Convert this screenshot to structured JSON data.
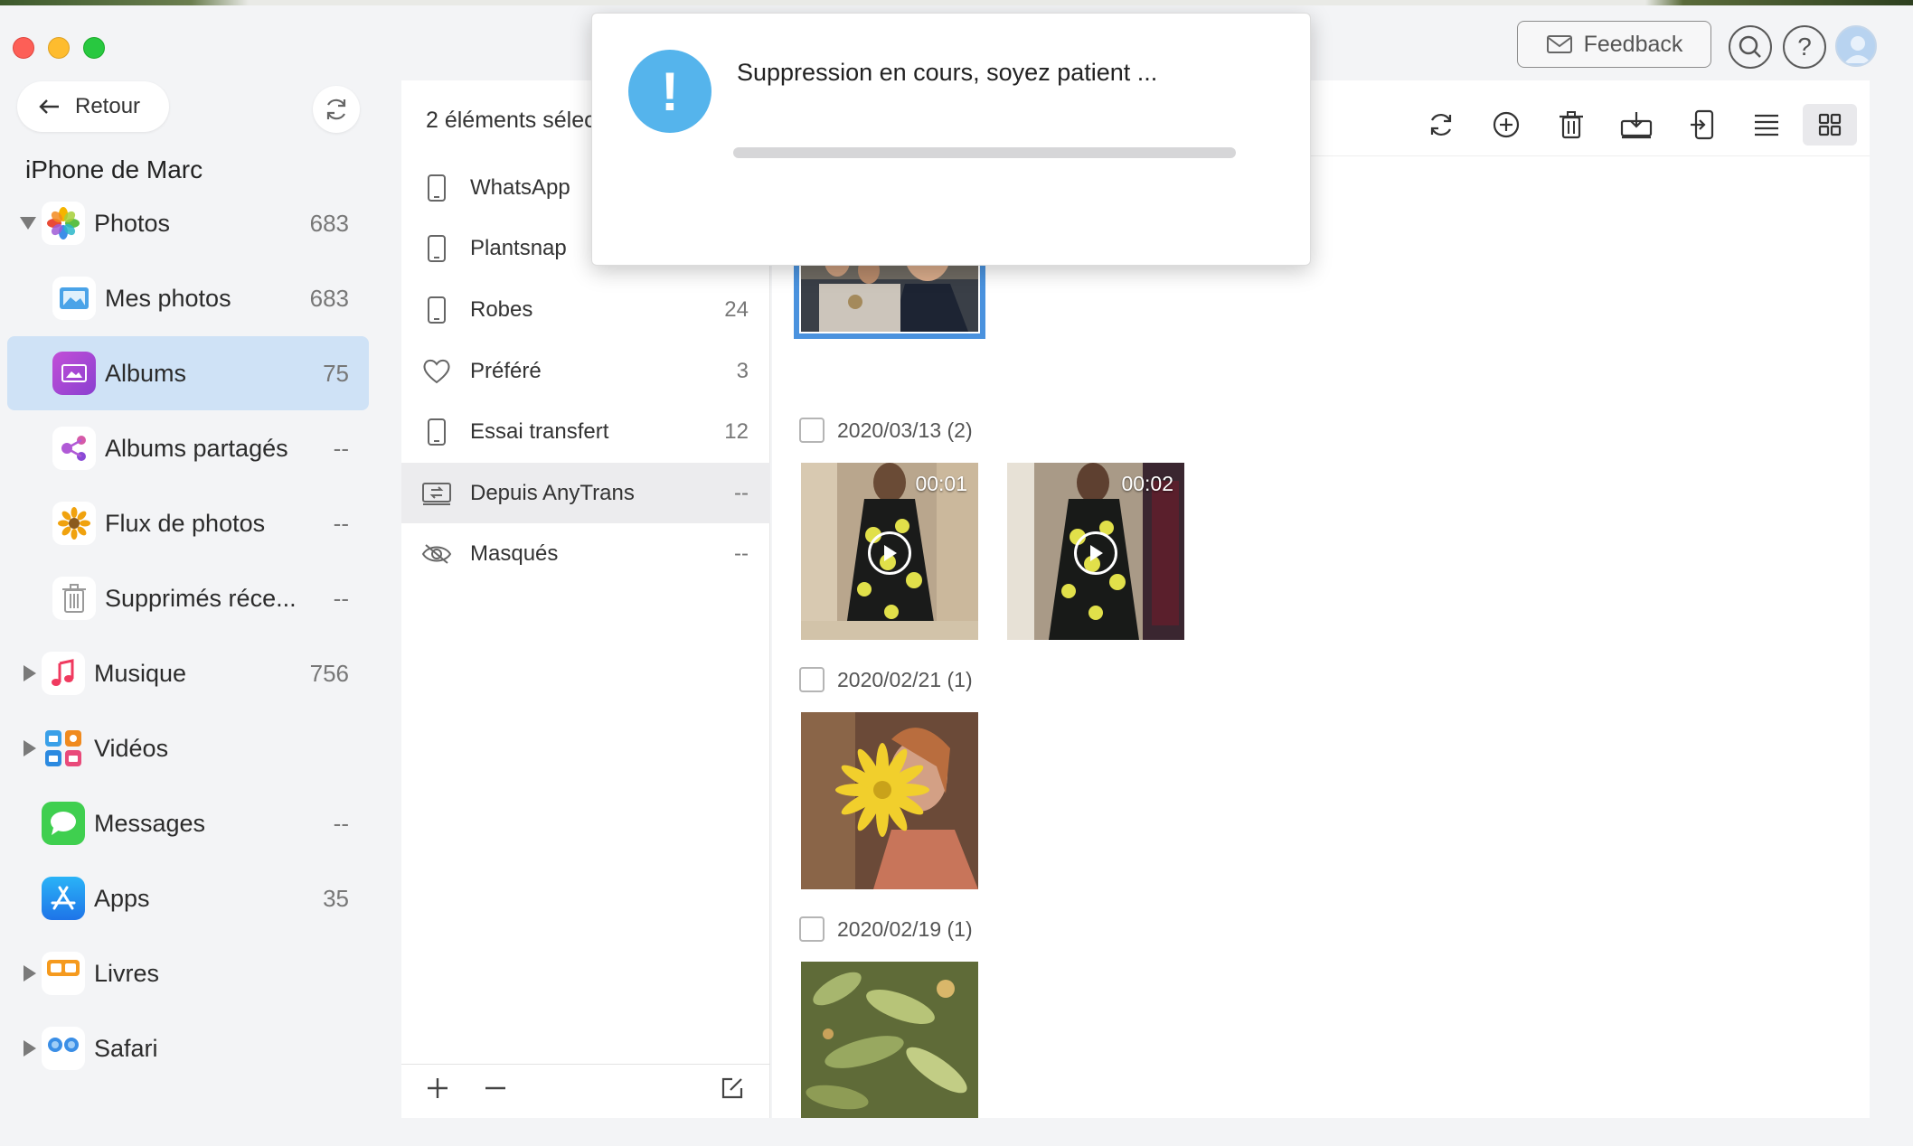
{
  "header": {
    "feedback_label": "Feedback",
    "help_label": "?"
  },
  "sidebar": {
    "back_label": "Retour",
    "device_name": "iPhone de Marc",
    "items": [
      {
        "label": "Photos",
        "count": "683"
      },
      {
        "label": "Mes photos",
        "count": "683"
      },
      {
        "label": "Albums",
        "count": "75"
      },
      {
        "label": "Albums partagés",
        "count": "--"
      },
      {
        "label": "Flux de photos",
        "count": "--"
      },
      {
        "label": "Supprimés réce...",
        "count": "--"
      },
      {
        "label": "Musique",
        "count": "756"
      },
      {
        "label": "Vidéos",
        "count": ""
      },
      {
        "label": "Messages",
        "count": "--"
      },
      {
        "label": "Apps",
        "count": "35"
      },
      {
        "label": "Livres",
        "count": ""
      },
      {
        "label": "Safari",
        "count": ""
      }
    ]
  },
  "albums": {
    "selection_text": "2 éléments sélec",
    "rows": [
      {
        "label": "WhatsApp",
        "count": ""
      },
      {
        "label": "Plantsnap",
        "count": ""
      },
      {
        "label": "Robes",
        "count": "24"
      },
      {
        "label": "Préféré",
        "count": "3"
      },
      {
        "label": "Essai transfert",
        "count": "12"
      },
      {
        "label": "Depuis AnyTrans",
        "count": "--"
      },
      {
        "label": "Masqués",
        "count": "--"
      }
    ]
  },
  "content": {
    "groups": [
      {
        "date": "2020/03/13 (2)",
        "durations": [
          "00:01",
          "00:02"
        ]
      },
      {
        "date": "2020/02/21 (1)"
      },
      {
        "date": "2020/02/19 (1)"
      }
    ]
  },
  "modal": {
    "message": "Suppression en cours, soyez patient ...",
    "icon": "!",
    "progress": 0
  },
  "colors": {
    "accent": "#4a92de",
    "selected_sidebar": "#cfe2f6",
    "warning_icon": "#55b4ec"
  }
}
